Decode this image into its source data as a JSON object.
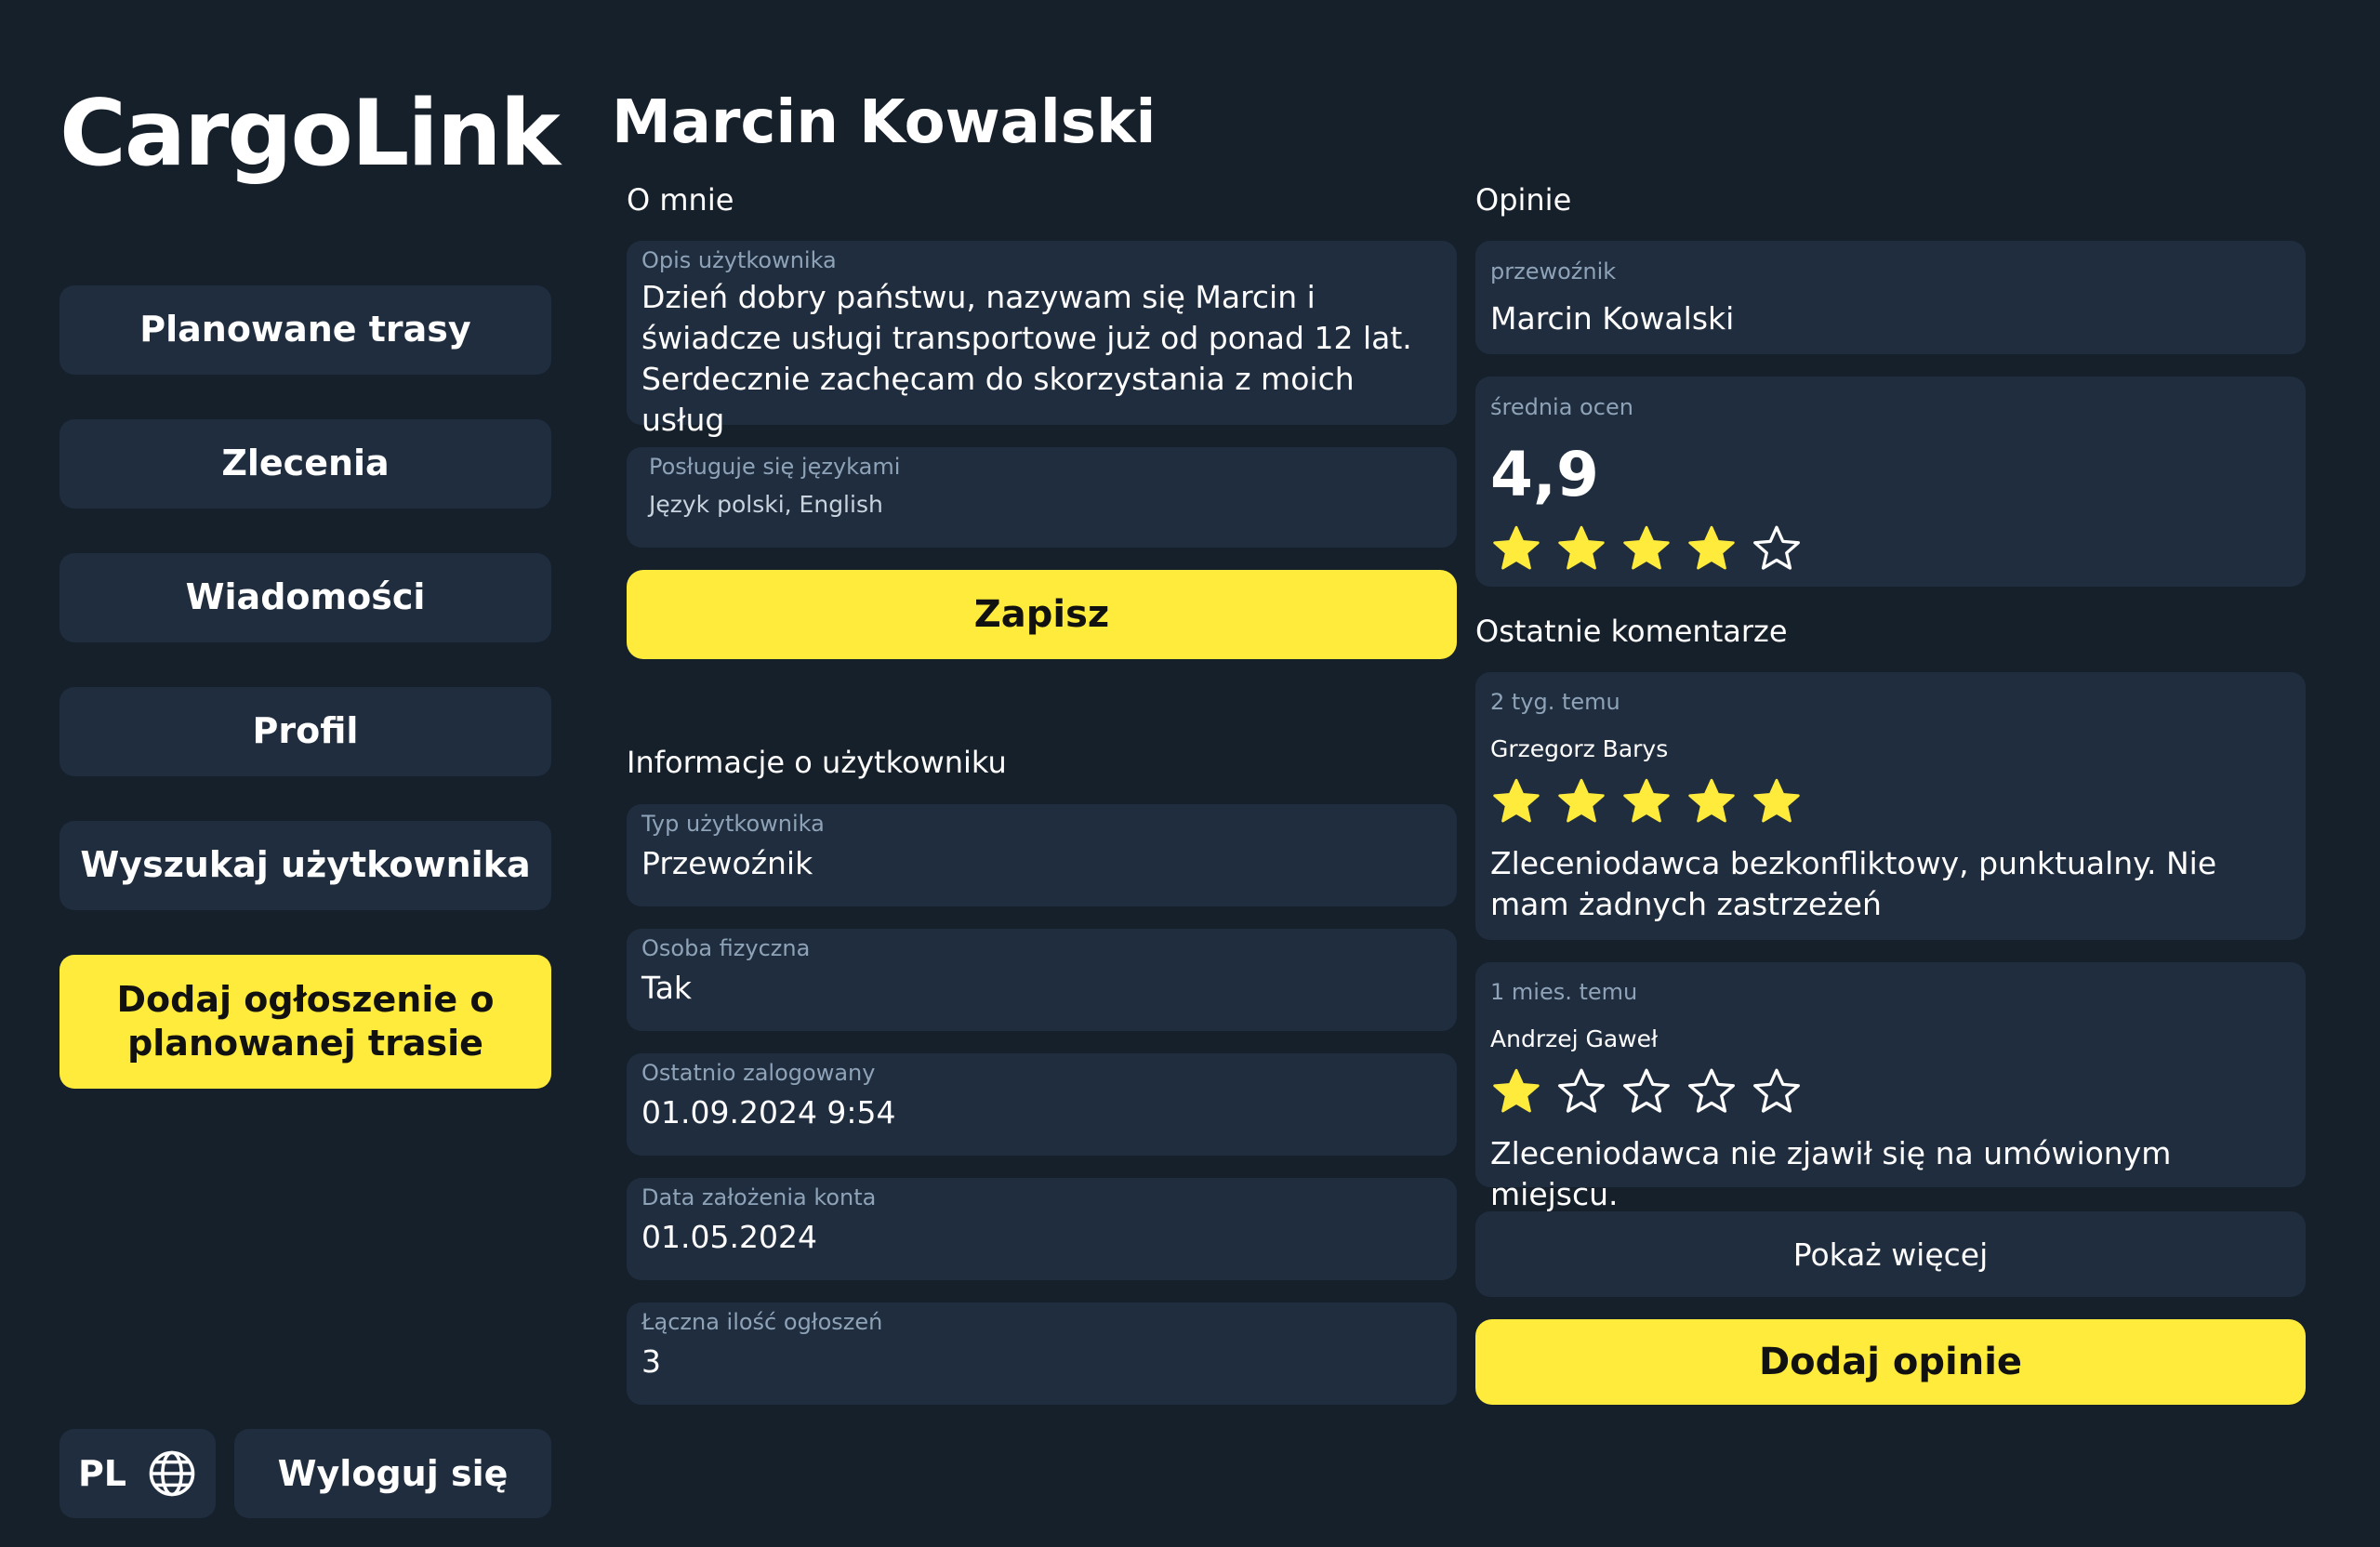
{
  "app": {
    "title": "CargoLink"
  },
  "sidebar": {
    "items": [
      {
        "label": "Planowane trasy"
      },
      {
        "label": "Zlecenia"
      },
      {
        "label": "Wiadomości"
      },
      {
        "label": "Profil"
      },
      {
        "label": "Wyszukaj użytkownika"
      },
      {
        "label": "Dodaj ogłoszenie o planowanej trasie"
      }
    ],
    "language": "PL",
    "language_icon": "globe-icon",
    "logout_label": "Wyloguj się"
  },
  "profile": {
    "name": "Marcin Kowalski",
    "about": {
      "section_label": "O mnie",
      "description_caption": "Opis użytkownika",
      "description": "Dzień dobry państwu, nazywam się Marcin i świadcze usługi transportowe już od ponad 12 lat. Serdecznie zachęcam do skorzystania z moich usług",
      "languages_caption": "Posługuje się językami",
      "languages": "Język polski, English",
      "save_label": "Zapisz"
    },
    "info": {
      "section_label": "Informacje o użytkowniku",
      "fields": [
        {
          "caption": "Typ użytkownika",
          "value": "Przewoźnik"
        },
        {
          "caption": "Osoba fizyczna",
          "value": "Tak"
        },
        {
          "caption": "Ostatnio zalogowany",
          "value": "01.09.2024 9:54"
        },
        {
          "caption": "Data założenia konta",
          "value": "01.05.2024"
        },
        {
          "caption": "Łączna ilość ogłoszeń",
          "value": "3"
        }
      ]
    }
  },
  "reviews": {
    "section_label": "Opinie",
    "carrier_caption": "przewoźnik",
    "carrier_name": "Marcin Kowalski",
    "average_caption": "średnia ocen",
    "average_value": "4,9",
    "average_stars": 4,
    "max_stars": 5,
    "recent_label": "Ostatnie komentarze",
    "comments": [
      {
        "time": "2 tyg. temu",
        "author": "Grzegorz Barys",
        "stars": 5,
        "text": "Zleceniodawca bezkonfliktowy, punktualny. Nie mam żadnych zastrzeżeń"
      },
      {
        "time": "1 mies. temu",
        "author": "Andrzej Gaweł",
        "stars": 1,
        "text": "Zleceniodawca nie zjawił się na umówionym miejscu."
      }
    ],
    "show_more_label": "Pokaż więcej",
    "add_review_label": "Dodaj opinie"
  },
  "colors": {
    "background": "#16202b",
    "card": "#1f2d3f",
    "accent": "#ffeb3b",
    "caption": "#8fa3b8"
  }
}
